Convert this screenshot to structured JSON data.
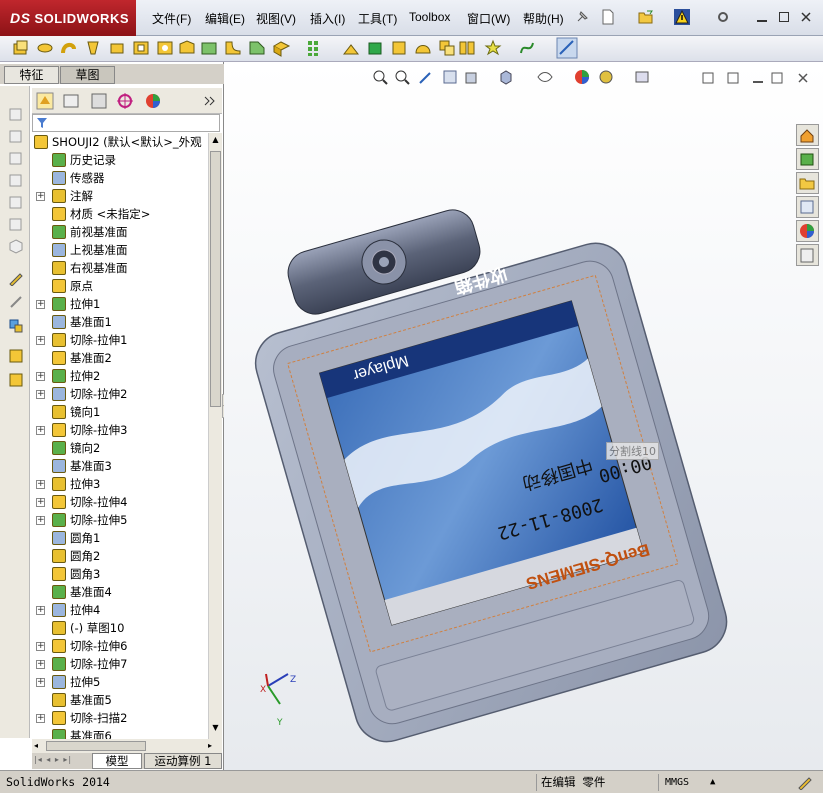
{
  "app": {
    "brand": "SOLIDWORKS",
    "brand_prefix": "DS"
  },
  "menu": [
    "文件(F)",
    "编辑(E)",
    "视图(V)",
    "插入(I)",
    "工具(T)",
    "Toolbox",
    "窗口(W)",
    "帮助(H)"
  ],
  "panel_tabs": [
    "特征",
    "草图"
  ],
  "tree": {
    "root": "SHOUJI2 (默认<默认>_外观",
    "items": [
      {
        "label": "历史记录",
        "expandable": false
      },
      {
        "label": "传感器",
        "expandable": false
      },
      {
        "label": "注解",
        "expandable": true
      },
      {
        "label": "材质 <未指定>",
        "expandable": false
      },
      {
        "label": "前视基准面",
        "expandable": false
      },
      {
        "label": "上视基准面",
        "expandable": false
      },
      {
        "label": "右视基准面",
        "expandable": false
      },
      {
        "label": "原点",
        "expandable": false
      },
      {
        "label": "拉伸1",
        "expandable": true
      },
      {
        "label": "基准面1",
        "expandable": false
      },
      {
        "label": "切除-拉伸1",
        "expandable": true
      },
      {
        "label": "基准面2",
        "expandable": false
      },
      {
        "label": "拉伸2",
        "expandable": true
      },
      {
        "label": "切除-拉伸2",
        "expandable": true
      },
      {
        "label": "镜向1",
        "expandable": false
      },
      {
        "label": "切除-拉伸3",
        "expandable": true
      },
      {
        "label": "镜向2",
        "expandable": false
      },
      {
        "label": "基准面3",
        "expandable": false
      },
      {
        "label": "拉伸3",
        "expandable": true
      },
      {
        "label": "切除-拉伸4",
        "expandable": true
      },
      {
        "label": "切除-拉伸5",
        "expandable": true
      },
      {
        "label": "圆角1",
        "expandable": false
      },
      {
        "label": "圆角2",
        "expandable": false
      },
      {
        "label": "圆角3",
        "expandable": false
      },
      {
        "label": "基准面4",
        "expandable": false
      },
      {
        "label": "拉伸4",
        "expandable": true
      },
      {
        "label": "(-) 草图10",
        "expandable": false
      },
      {
        "label": "切除-拉伸6",
        "expandable": true
      },
      {
        "label": "切除-拉伸7",
        "expandable": true
      },
      {
        "label": "拉伸5",
        "expandable": true
      },
      {
        "label": "基准面5",
        "expandable": false
      },
      {
        "label": "切除-扫描2",
        "expandable": true
      },
      {
        "label": "基准面6",
        "expandable": false
      }
    ]
  },
  "bottom_tabs": [
    "模型",
    "运动算例 1"
  ],
  "viewport": {
    "tooltip": "分割线10",
    "screen": {
      "title": "收件箱",
      "player": "Mplayer",
      "time": "00:00",
      "carrier": "中国移动",
      "date": "2008-11-22",
      "brand": "BenQ-SIEMENS"
    },
    "axis_labels": [
      "Z",
      "X",
      "Y"
    ]
  },
  "status": {
    "app": "SolidWorks 2014",
    "mode": "在编辑 零件",
    "units": "MMGS"
  },
  "colors": {
    "brand_red": "#a8181e",
    "phone_body": "#9aa3b8",
    "screen_border": "#d08040"
  }
}
